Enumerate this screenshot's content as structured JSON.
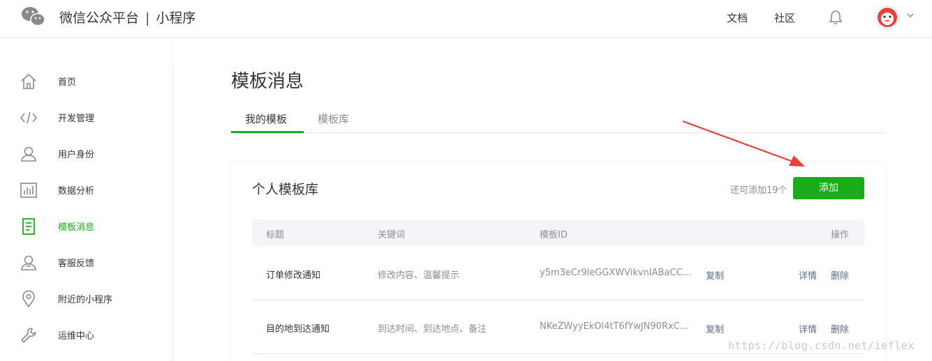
{
  "header": {
    "brand_main": "微信公众平台",
    "brand_separator": "|",
    "brand_sub": "小程序",
    "nav": [
      "文档",
      "社区"
    ],
    "icons": [
      "wechat-logo-icon",
      "bell-icon",
      "avatar",
      "chevron-down-icon"
    ]
  },
  "sidebar": {
    "items": [
      {
        "label": "首页",
        "icon": "home-icon"
      },
      {
        "label": "开发管理",
        "icon": "code-icon"
      },
      {
        "label": "用户身份",
        "icon": "user-icon"
      },
      {
        "label": "数据分析",
        "icon": "bar-chart-icon"
      },
      {
        "label": "模板消息",
        "icon": "document-icon",
        "active": true
      },
      {
        "label": "客服反馈",
        "icon": "service-user-icon"
      },
      {
        "label": "附近的小程序",
        "icon": "location-pin-icon"
      },
      {
        "label": "运维中心",
        "icon": "wrench-icon"
      }
    ]
  },
  "main": {
    "title": "模板消息",
    "tabs": [
      {
        "label": "我的模板",
        "active": true
      },
      {
        "label": "模板库",
        "active": false
      }
    ],
    "card": {
      "title": "个人模板库",
      "quota_text": "还可添加19个",
      "add_button": "添加",
      "columns": [
        "标题",
        "关键词",
        "模板ID",
        "操作"
      ],
      "rows": [
        {
          "title": "订单修改通知",
          "keywords": "修改内容、温馨提示",
          "template_id": "y5m3eCr9leGGXWVikvnIABaCC...",
          "copy": "复制",
          "detail": "详情",
          "delete": "删除"
        },
        {
          "title": "目的地到达通知",
          "keywords": "到达时间、到达地点、备注",
          "template_id": "NKeZWyyEkOl4tT6fYwJN90RxC...",
          "copy": "复制",
          "detail": "详情",
          "delete": "删除"
        }
      ]
    }
  },
  "watermark": "https://blog.csdn.net/ieflex",
  "colors": {
    "accent": "#1aad19",
    "link": "#576b95",
    "arrow": "#e8413a"
  }
}
